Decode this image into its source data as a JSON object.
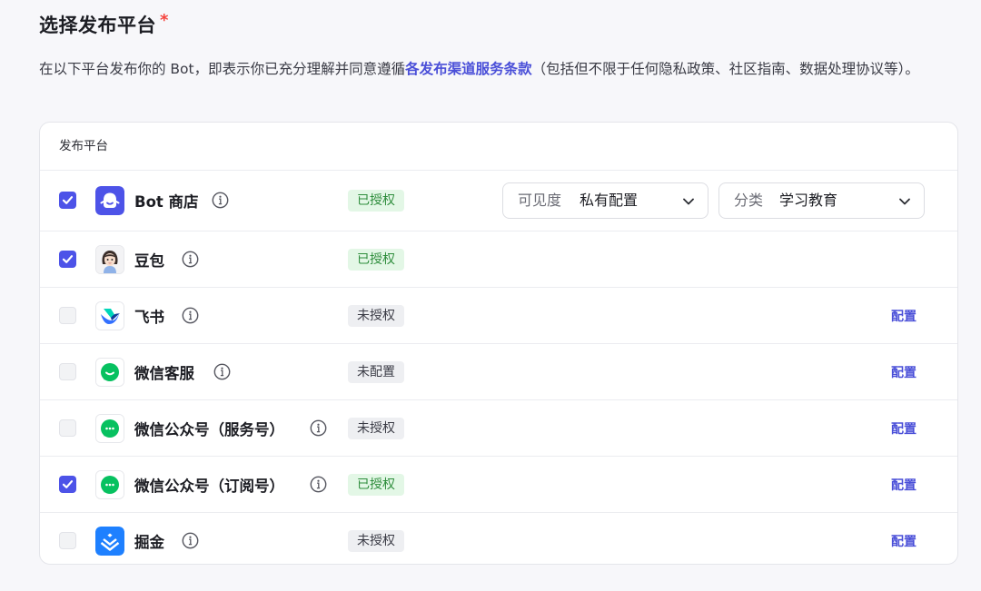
{
  "section": {
    "title": "选择发布平台",
    "required_mark": "*",
    "desc_before": "在以下平台发布你的 Bot，即表示你已充分理解并同意遵循",
    "desc_link": "各发布渠道服务条款",
    "desc_after": "（包括但不限于任何隐私政策、社区指南、数据处理协议等）。"
  },
  "panel": {
    "header": "发布平台",
    "config_label": "配置",
    "visibility": {
      "label": "可见度",
      "value": "私有配置"
    },
    "category": {
      "label": "分类",
      "value": "学习教育"
    },
    "rows": [
      {
        "name": "Bot 商店",
        "checked": true,
        "status": "已授权",
        "status_type": "ok",
        "icon": "bot-store-icon"
      },
      {
        "name": "豆包",
        "checked": true,
        "status": "已授权",
        "status_type": "ok",
        "icon": "doubao-avatar-icon"
      },
      {
        "name": "飞书",
        "checked": false,
        "status": "未授权",
        "status_type": "no",
        "icon": "feishu-icon"
      },
      {
        "name": "微信客服",
        "checked": false,
        "status": "未配置",
        "status_type": "no",
        "icon": "wechat-service-icon"
      },
      {
        "name": "微信公众号（服务号）",
        "checked": false,
        "status": "未授权",
        "status_type": "no",
        "icon": "wechat-icon"
      },
      {
        "name": "微信公众号（订阅号）",
        "checked": true,
        "status": "已授权",
        "status_type": "ok",
        "icon": "wechat-icon"
      },
      {
        "name": "掘金",
        "checked": false,
        "status": "未授权",
        "status_type": "no",
        "icon": "juejin-icon"
      }
    ]
  },
  "colors": {
    "accent": "#4d53e8",
    "link": "#4a4fd8",
    "ok_bg": "#e3f7e6",
    "ok_text": "#2e8d3c",
    "wechat_green": "#07c160",
    "required": "#f5433d"
  }
}
